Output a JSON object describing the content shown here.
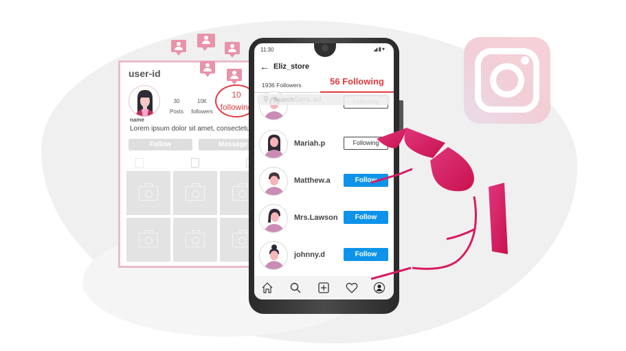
{
  "background_profile": {
    "user_id": "user-id",
    "stats": {
      "posts": {
        "value": "30",
        "label": "Posts"
      },
      "followers": {
        "value": "10K",
        "label": "followers"
      },
      "following": {
        "value": "10",
        "label": "following"
      }
    },
    "name": "name",
    "bio": "Lorem ipsum dolor sit amet, consectetur",
    "follow_button": "Follow",
    "message_button": "Message"
  },
  "phone": {
    "status_bar": {
      "time": "11:30",
      "icons": "◢▮▾"
    },
    "header": {
      "title": "Eliz_store",
      "back_icon": "←"
    },
    "tabs": [
      {
        "label": "1936 Followers",
        "active": false
      },
      {
        "label": "56 Following",
        "active": true
      }
    ],
    "search": {
      "placeholder": "Search",
      "value": ""
    },
    "following_list": [
      {
        "username": "Sara.ad",
        "button": "Following",
        "state": "following",
        "avatar": "female-short-hair"
      },
      {
        "username": "Mariah.p",
        "button": "Following",
        "state": "following",
        "avatar": "female-long-hair"
      },
      {
        "username": "Matthew.a",
        "button": "Follow",
        "state": "follow",
        "avatar": "male"
      },
      {
        "username": "Mrs.Lawson",
        "button": "Follow",
        "state": "follow",
        "avatar": "female-bob"
      },
      {
        "username": "johnny.d",
        "button": "Follow",
        "state": "follow",
        "avatar": "male-bun"
      }
    ],
    "bottom_nav": [
      "home-icon",
      "search-icon",
      "add-post-icon",
      "heart-icon",
      "profile-icon"
    ]
  },
  "colors": {
    "accent_red": "#e0393f",
    "follow_blue": "#0f93ea",
    "hand_pink": "#d91a63",
    "notification_pink": "#e893ab"
  }
}
